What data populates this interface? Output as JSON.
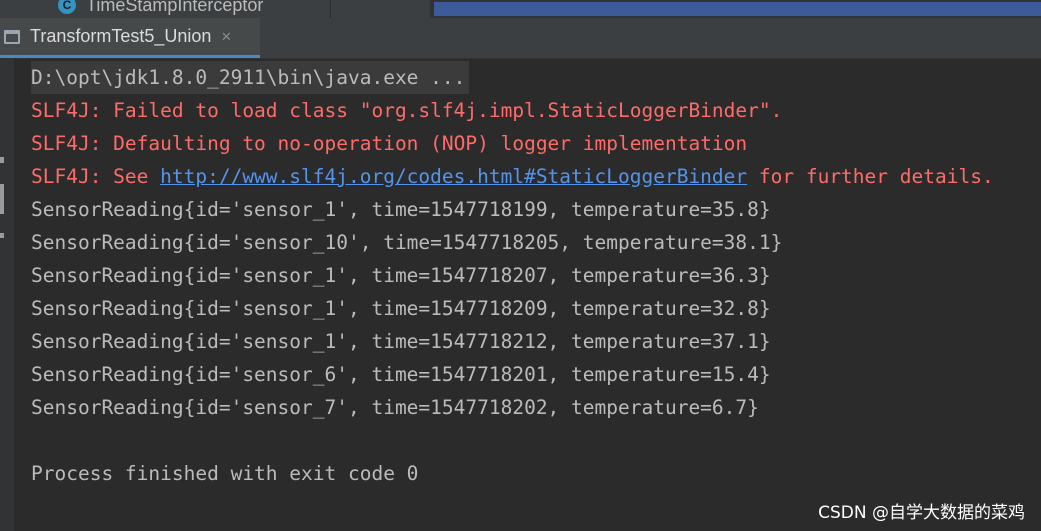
{
  "top_strip": {
    "file_label": "TimeStampInterceptor",
    "file_icon_letter": "C"
  },
  "tab": {
    "label": "TransformTest5_Union",
    "close_glyph": "×"
  },
  "console": {
    "command_line": "D:\\opt\\jdk1.8.0_2911\\bin\\java.exe ...",
    "errors": [
      "SLF4J: Failed to load class \"org.slf4j.impl.StaticLoggerBinder\".",
      "SLF4J: Defaulting to no-operation (NOP) logger implementation"
    ],
    "see_prefix": "SLF4J: See ",
    "see_link": "http://www.slf4j.org/codes.html#StaticLoggerBinder",
    "see_suffix": " for further details.",
    "output": [
      "SensorReading{id='sensor_1', time=1547718199, temperature=35.8}",
      "SensorReading{id='sensor_10', time=1547718205, temperature=38.1}",
      "SensorReading{id='sensor_1', time=1547718207, temperature=36.3}",
      "SensorReading{id='sensor_1', time=1547718209, temperature=32.8}",
      "SensorReading{id='sensor_1', time=1547718212, temperature=37.1}",
      "SensorReading{id='sensor_6', time=1547718201, temperature=15.4}",
      "SensorReading{id='sensor_7', time=1547718202, temperature=6.7}"
    ],
    "finished": "Process finished with exit code 0"
  },
  "watermark": "CSDN @自学大数据的菜鸡",
  "colors": {
    "background": "#2b2b2b",
    "error_text": "#ff6b68",
    "link": "#5394ec",
    "normal_text": "#bbbbbb",
    "tab_underline": "#4a88c7"
  }
}
